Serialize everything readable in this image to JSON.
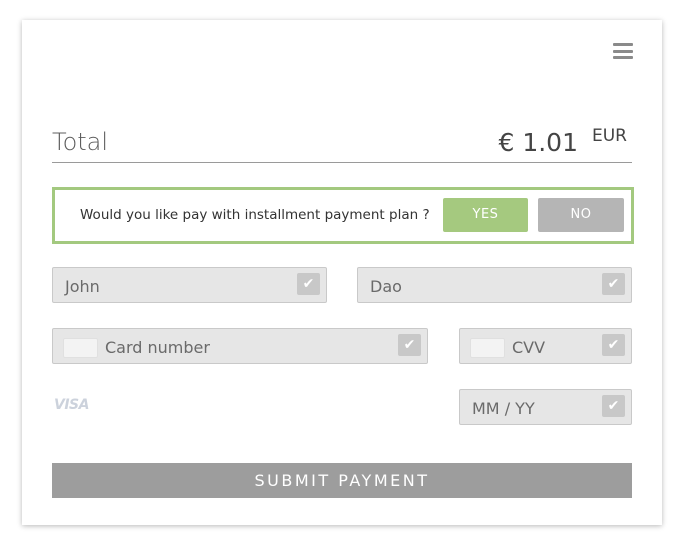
{
  "header": {
    "menu_icon": "hamburger-menu-icon"
  },
  "total": {
    "label": "Total",
    "amount": "€ 1.01",
    "currency": "EUR"
  },
  "installment": {
    "question": "Would you like pay with installment payment plan ?",
    "yes_label": "YES",
    "no_label": "NO",
    "accent_color": "#a3c97f"
  },
  "fields": {
    "first_name": "John",
    "last_name": "Dao",
    "card_number_placeholder": "Card number",
    "cvv_placeholder": "CVV",
    "expiry_placeholder": "MM / YY"
  },
  "card_brand": "VISA",
  "submit_label": "SUBMIT PAYMENT"
}
